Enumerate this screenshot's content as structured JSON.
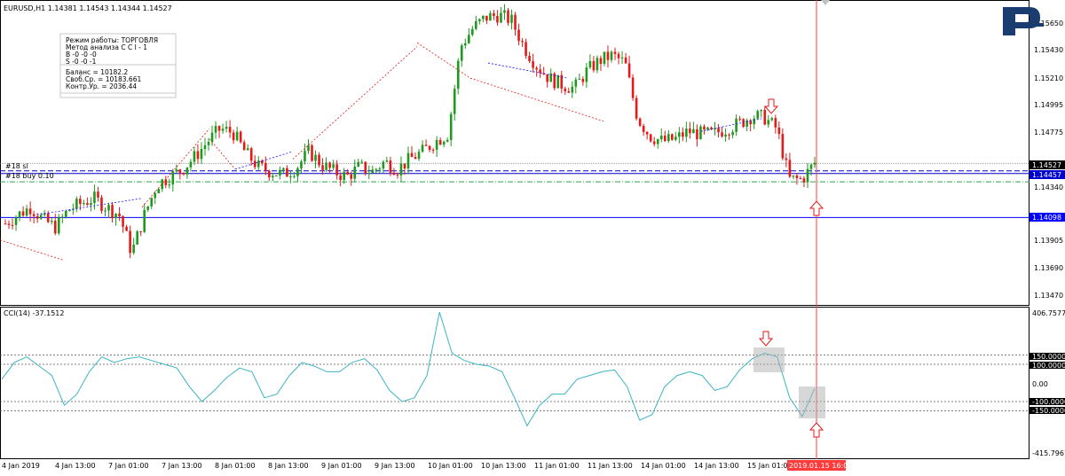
{
  "window": {
    "symbol_header": "EURUSD,H1  1.14381 1.14543 1.14344 1.14527"
  },
  "info_panel": {
    "mode": "Режим работы: ТОРГОВЛЯ",
    "method": "Метод анализа С С I - 1",
    "row_b": "B   -0    -0     -0",
    "row_s": "S   -0    -0     -1",
    "balance": "Баланс        = 10182.2",
    "free": "Своб.Ср.     = 10183.661",
    "control": "Контр.Ур.   = 2036.44"
  },
  "order_labels": {
    "sl": "#18 sl",
    "buy": "#18 buy 0.10"
  },
  "price_axis": {
    "ticks": [
      "1.15650",
      "1.15430",
      "1.15210",
      "1.14995",
      "1.14775",
      "1.14555",
      "1.14340",
      "1.14120",
      "1.13905",
      "1.13690",
      "1.13470"
    ],
    "current_price": "1.14527",
    "sl_price": "1.14457",
    "blue_line_price": "1.14098"
  },
  "indicator": {
    "title": "CCI(14) -37.1512",
    "ticks": [
      "406.7577",
      "150.0000",
      "100.0000",
      "0.00",
      "-100.0000",
      "-150.0000",
      "-415.7967"
    ]
  },
  "time_axis": {
    "labels": [
      "4 Jan 2019",
      "4 Jan 13:00",
      "7 Jan 01:00",
      "7 Jan 13:00",
      "8 Jan 01:00",
      "8 Jan 13:00",
      "9 Jan 01:00",
      "9 Jan 13:00",
      "10 Jan 01:00",
      "10 Jan 13:00",
      "11 Jan 01:00",
      "11 Jan 13:00",
      "14 Jan 01:00",
      "14 Jan 13:00",
      "15 Jan 01:00"
    ],
    "cursor_time": "2019.01.15 16:00"
  },
  "colors": {
    "bull": "#1f9a1f",
    "bear": "#e41a1a",
    "cci_line": "#3cb3c4",
    "cursor": "#ff3b3b",
    "order_line": "#0000cc"
  },
  "logo": "RoboForex",
  "chart_data": {
    "type": "candlestick",
    "symbol": "EURUSD",
    "timeframe": "H1",
    "ohlc_header": {
      "open": 1.14381,
      "high": 1.14543,
      "low": 1.14344,
      "close": 1.14527
    },
    "close_path": [
      1.1405,
      1.1412,
      1.1418,
      1.1408,
      1.1402,
      1.1416,
      1.1421,
      1.1425,
      1.1418,
      1.1412,
      1.1382,
      1.1412,
      1.1436,
      1.1442,
      1.1448,
      1.1458,
      1.147,
      1.148,
      1.1477,
      1.1461,
      1.145,
      1.1446,
      1.1444,
      1.1449,
      1.1462,
      1.1452,
      1.1446,
      1.1442,
      1.145,
      1.1446,
      1.1454,
      1.1448,
      1.1456,
      1.1462,
      1.147,
      1.1476,
      1.1545,
      1.156,
      1.1568,
      1.157,
      1.1566,
      1.1545,
      1.153,
      1.152,
      1.1515,
      1.1512,
      1.1526,
      1.1534,
      1.1538,
      1.1532,
      1.1488,
      1.1474,
      1.147,
      1.1472,
      1.1478,
      1.1476,
      1.1476,
      1.148,
      1.1484,
      1.149,
      1.1489,
      1.148,
      1.144,
      1.144,
      1.1453
    ],
    "cci_path": [
      20,
      110,
      140,
      90,
      40,
      -120,
      -60,
      60,
      140,
      110,
      130,
      140,
      120,
      100,
      80,
      -20,
      -100,
      -40,
      30,
      80,
      60,
      -80,
      -60,
      40,
      110,
      90,
      60,
      60,
      110,
      130,
      70,
      -40,
      -100,
      -80,
      40,
      380,
      160,
      120,
      100,
      90,
      60,
      -80,
      -230,
      -120,
      -60,
      -60,
      20,
      40,
      60,
      70,
      -20,
      -200,
      -170,
      -20,
      40,
      60,
      40,
      -40,
      -20,
      70,
      130,
      160,
      140,
      -80,
      -180,
      -30
    ],
    "levels": {
      "sl": 1.14457,
      "blue": 1.14098,
      "green_dash": 1.1438
    },
    "cci_levels": [
      150,
      100,
      -100,
      -150
    ]
  }
}
